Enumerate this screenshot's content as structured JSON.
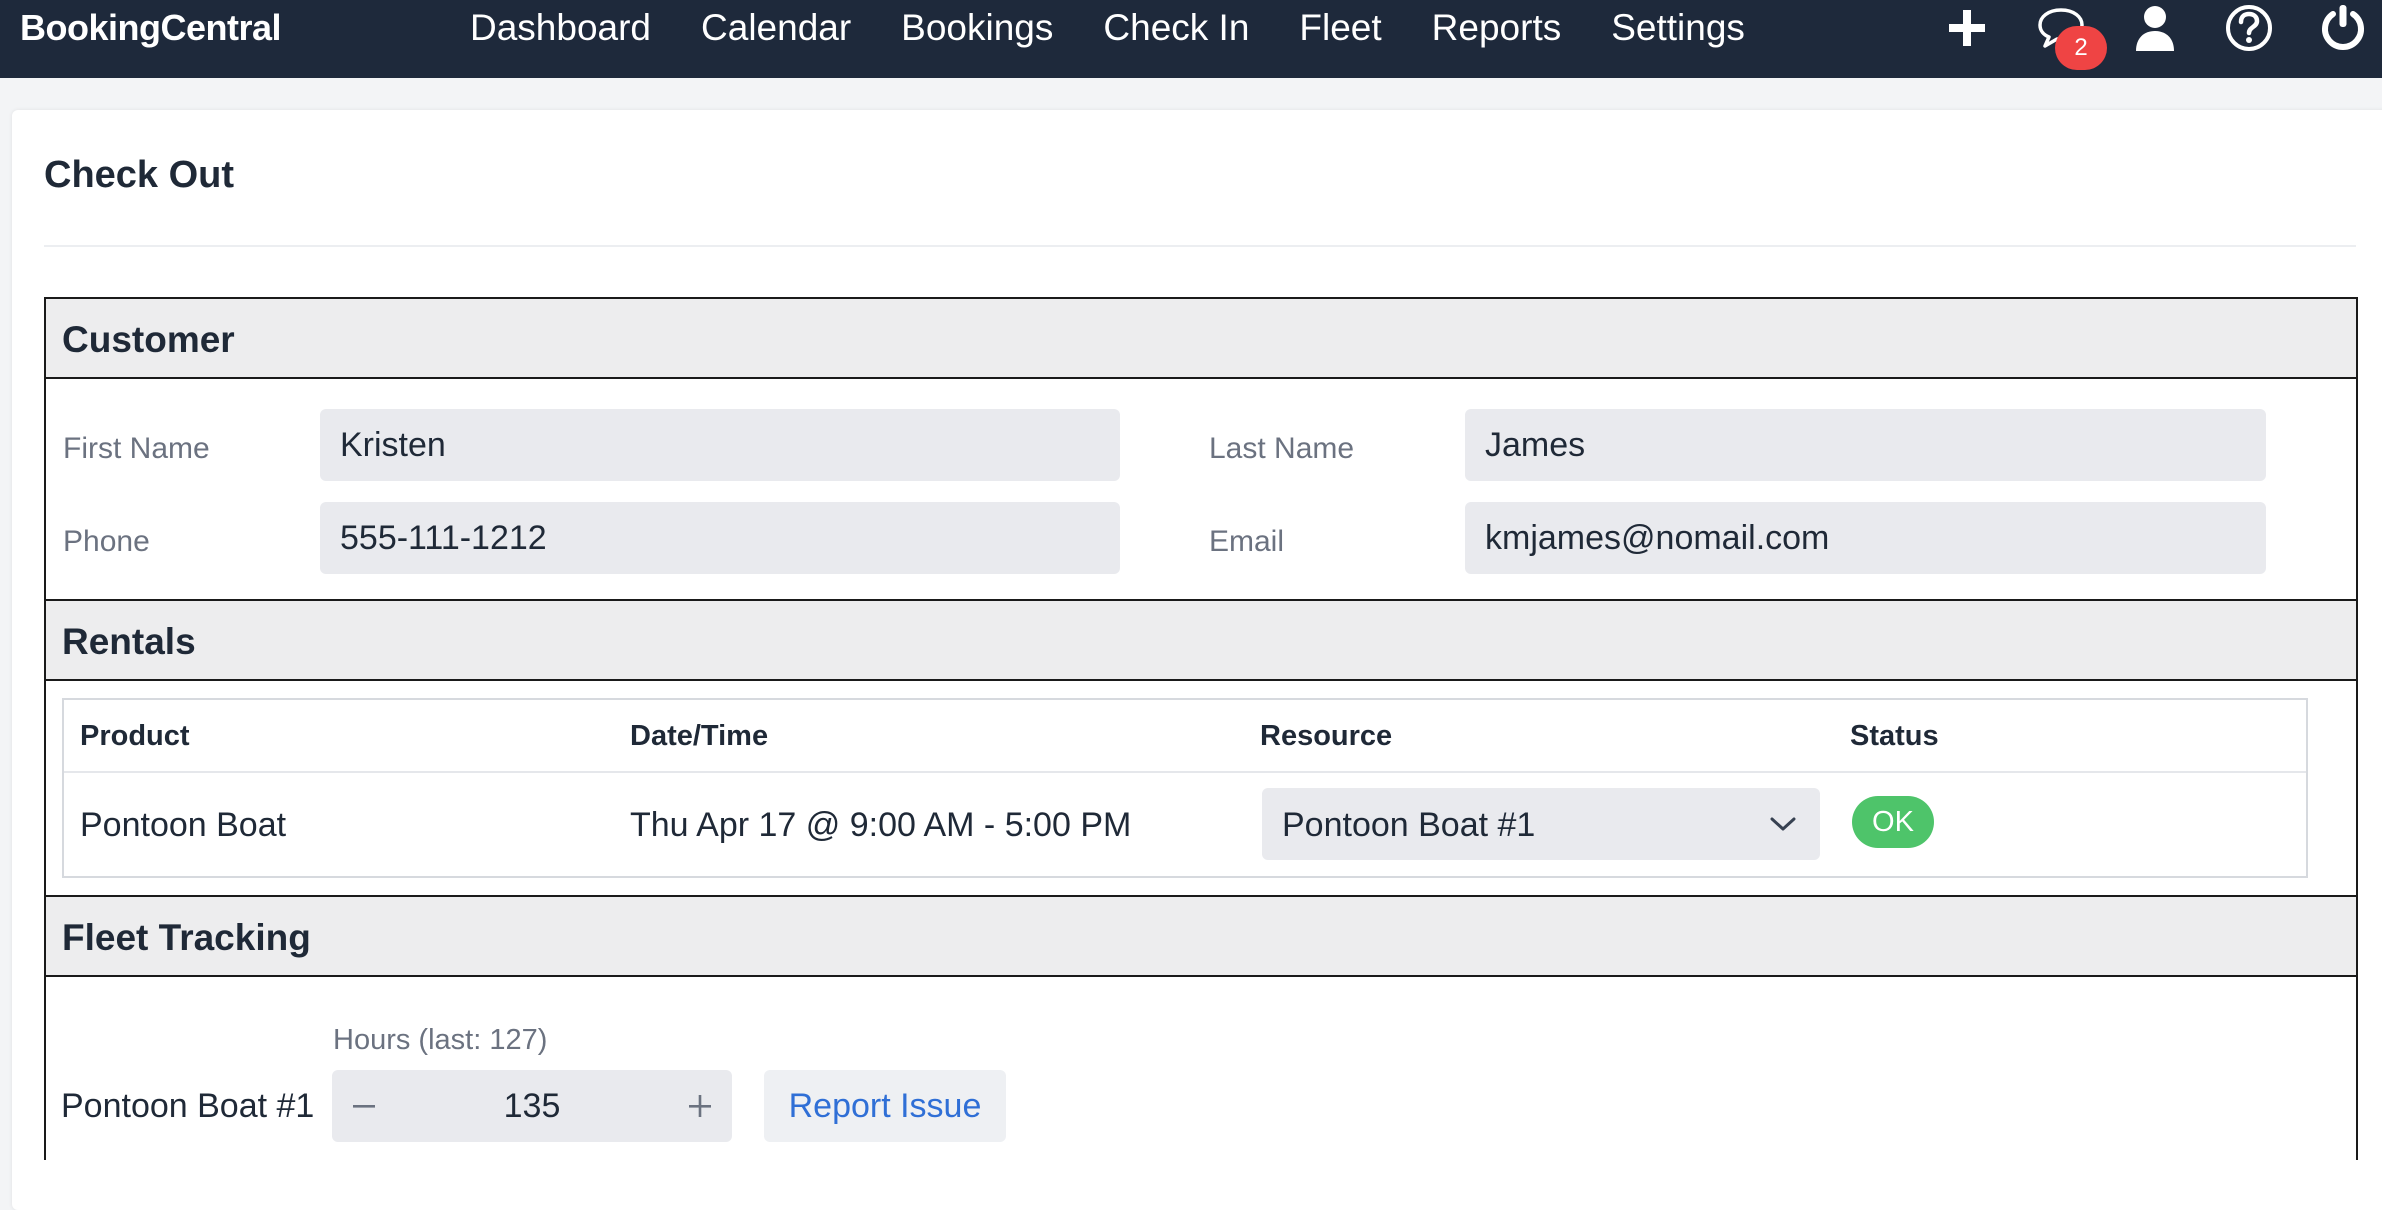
{
  "app": {
    "brand": "BookingCentral"
  },
  "nav": {
    "links": [
      "Dashboard",
      "Calendar",
      "Bookings",
      "Check In",
      "Fleet",
      "Reports",
      "Settings"
    ],
    "icons": [
      "plus-icon",
      "chat-icon",
      "user-icon",
      "help-icon",
      "power-icon"
    ],
    "messages_badge": "2"
  },
  "page": {
    "title": "Check Out"
  },
  "customer": {
    "heading": "Customer",
    "first_name_label": "First Name",
    "first_name": "Kristen",
    "last_name_label": "Last Name",
    "last_name": "James",
    "phone_label": "Phone",
    "phone": "555-111-1212",
    "email_label": "Email",
    "email": "kmjames@nomail.com"
  },
  "rentals": {
    "heading": "Rentals",
    "columns": [
      "Product",
      "Date/Time",
      "Resource",
      "Status"
    ],
    "rows": [
      {
        "product": "Pontoon Boat",
        "datetime": "Thu Apr 17 @ 9:00 AM - 5:00 PM",
        "resource": "Pontoon Boat #1",
        "status": "OK"
      }
    ]
  },
  "fleet": {
    "heading": "Fleet Tracking",
    "item_name": "Pontoon Boat #1",
    "hours_label": "Hours (last: 127)",
    "hours_value": "135",
    "report_label": "Report Issue"
  },
  "colors": {
    "navbar": "#1e293b",
    "badge": "#ef4444",
    "status_ok": "#4ec46a",
    "link": "#2f6fd6"
  }
}
